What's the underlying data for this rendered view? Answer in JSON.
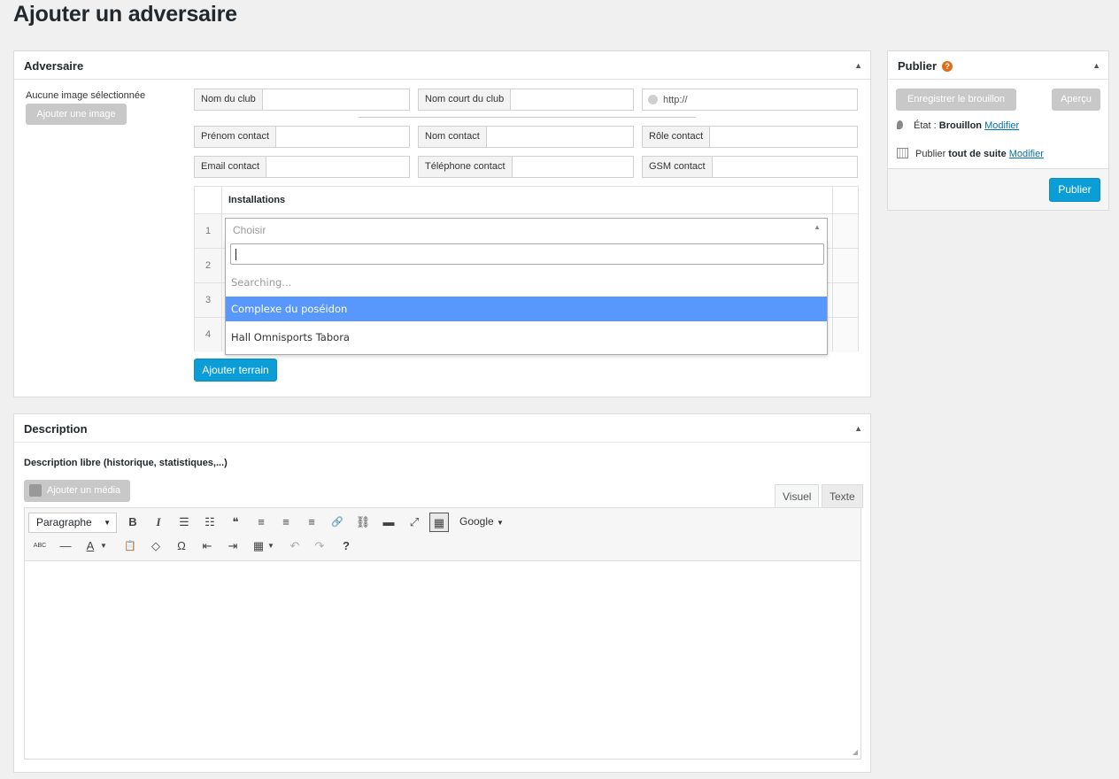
{
  "page": {
    "title": "Ajouter un adversaire"
  },
  "adversaire": {
    "box_title": "Adversaire",
    "no_image_text": "Aucune image sélectionnée",
    "add_image_label": "Ajouter une image",
    "fields": {
      "club_name": "Nom du club",
      "short_name": "Nom court du club",
      "url_value": "http://",
      "first_name": "Prénom contact",
      "last_name": "Nom contact",
      "role": "Rôle contact",
      "email": "Email contact",
      "phone": "Téléphone contact",
      "gsm": "GSM contact"
    },
    "installations": {
      "title": "Installations",
      "rows": [
        "1",
        "2",
        "3",
        "4"
      ],
      "select_placeholder": "Choisir",
      "search_value": "",
      "searching_text": "Searching...",
      "options": [
        "Complexe du poséidon",
        "Hall Omnisports Tabora"
      ]
    },
    "add_field_label": "Ajouter terrain"
  },
  "description": {
    "box_title": "Description",
    "label": "Description libre (historique, statistiques,...)",
    "add_media_label": "Ajouter un média",
    "tabs": {
      "visual": "Visuel",
      "text": "Texte"
    },
    "format_select": "Paragraphe",
    "font_menu": "Google",
    "toolbar_glyphs": {
      "bold": "B",
      "italic": "I",
      "bullets": "☰",
      "numbers": "☷",
      "quote": "❝",
      "align_left": "≡",
      "align_center": "≡",
      "align_right": "≡",
      "link": "🔗",
      "unlink": "⛓",
      "more": "▬",
      "fullscreen": "⤢",
      "kitchen": "▦",
      "strike": "ABC",
      "hr": "—",
      "textcolor": "A",
      "paste": "📋",
      "clear": "◇",
      "omega": "Ω",
      "outdent": "⇤",
      "indent": "⇥",
      "table": "▦",
      "undo": "↶",
      "redo": "↷",
      "help": "?"
    }
  },
  "publish": {
    "box_title": "Publier",
    "help_glyph": "?",
    "save_draft_label": "Enregistrer le brouillon",
    "preview_label": "Aperçu",
    "status_prefix": "État : ",
    "status_value": "Brouillon",
    "modify_label": "Modifier",
    "publish_prefix": "Publier ",
    "publish_when": "tout de suite",
    "publish_button": "Publier"
  },
  "colors": {
    "primary": "#0b9ed6",
    "highlight": "#5897fb",
    "help": "#e06c1a",
    "link": "#0073aa"
  }
}
